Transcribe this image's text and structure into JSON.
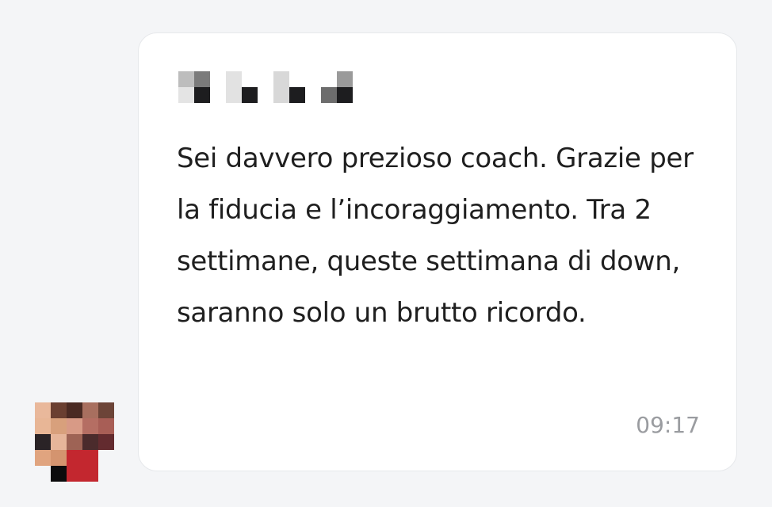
{
  "colors": {
    "background": "#f4f5f7",
    "bubble": "#ffffff",
    "text": "#1f1f1f",
    "timestamp": "#9a9ca0"
  },
  "message": {
    "sender_name_redacted": true,
    "text": "Sei davvero prezioso coach. Grazie per la fiducia e l’incoraggiamento. Tra 2 settimane, queste settimana di down, saranno solo un brutto ricordo.",
    "time": "09:17"
  }
}
